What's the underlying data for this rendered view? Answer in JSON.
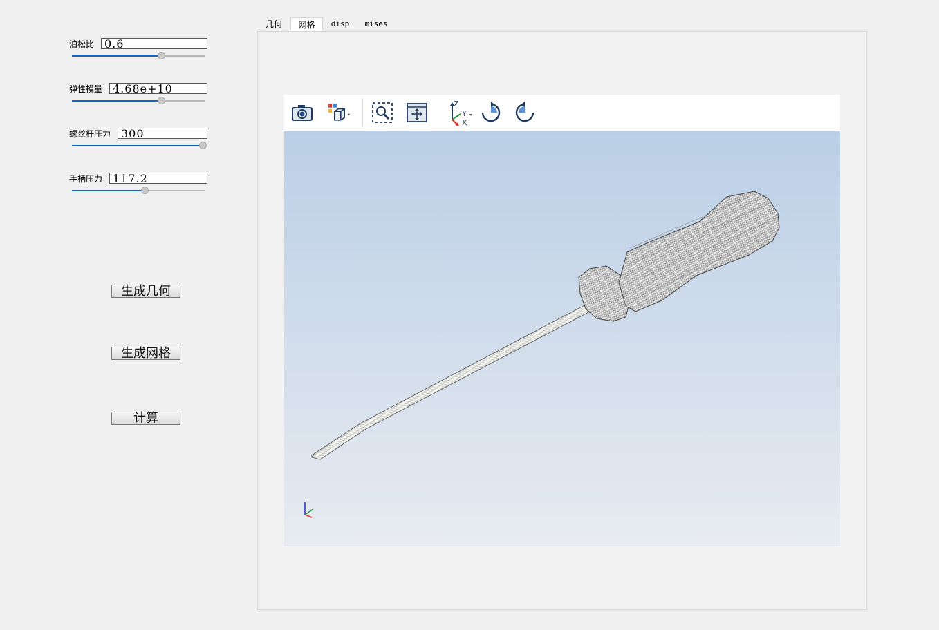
{
  "params": [
    {
      "label": "泊松比",
      "value": "0.6",
      "fill": 0.68
    },
    {
      "label": "弹性模量",
      "value": "4.68e+10",
      "fill": 0.68
    },
    {
      "label": "螺丝杆压力",
      "value": "300",
      "fill": 1.0
    },
    {
      "label": "手柄压力",
      "value": "117.2",
      "fill": 0.55
    }
  ],
  "buttons": {
    "gen_geometry": "生成几何",
    "gen_mesh": "生成网格",
    "compute": "计算"
  },
  "tabs": [
    {
      "label": "几何",
      "active": false
    },
    {
      "label": "网格",
      "active": true
    },
    {
      "label": "disp",
      "active": false
    },
    {
      "label": "mises",
      "active": false
    }
  ],
  "toolbar": {
    "icons": [
      "camera-icon",
      "view-cube-icon",
      "zoom-box-icon",
      "fit-view-icon",
      "axes-orientation-icon",
      "rotate-cw-icon",
      "rotate-ccw-icon"
    ],
    "axis_labels": {
      "z": "Z",
      "y": "Y",
      "x": "X"
    }
  },
  "colors": {
    "accent": "#0f64c8",
    "viewport_top": "#bacfe6",
    "viewport_bottom": "#e8ebf1",
    "icon": "#1e3a5f"
  }
}
